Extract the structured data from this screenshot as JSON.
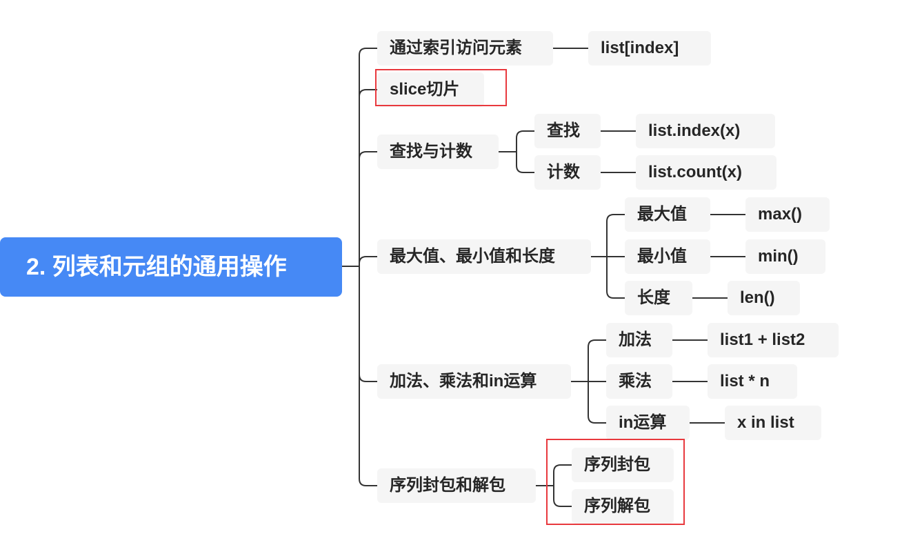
{
  "mindmap": {
    "root": {
      "label": "2. 列表和元组的通用操作",
      "color": "#4689f5"
    },
    "branches": [
      {
        "label": "通过索引访问元素",
        "children": [
          {
            "label": "list[index]"
          }
        ]
      },
      {
        "label": "slice切片",
        "highlighted": true,
        "children": []
      },
      {
        "label": "查找与计数",
        "children": [
          {
            "label": "查找",
            "children": [
              {
                "label": "list.index(x)"
              }
            ]
          },
          {
            "label": "计数",
            "children": [
              {
                "label": "list.count(x)"
              }
            ]
          }
        ]
      },
      {
        "label": "最大值、最小值和长度",
        "children": [
          {
            "label": "最大值",
            "children": [
              {
                "label": "max()"
              }
            ]
          },
          {
            "label": "最小值",
            "children": [
              {
                "label": "min()"
              }
            ]
          },
          {
            "label": "长度",
            "children": [
              {
                "label": "len()"
              }
            ]
          }
        ]
      },
      {
        "label": "加法、乘法和in运算",
        "children": [
          {
            "label": "加法",
            "children": [
              {
                "label": "list1 + list2"
              }
            ]
          },
          {
            "label": "乘法",
            "children": [
              {
                "label": "list * n"
              }
            ]
          },
          {
            "label": "in运算",
            "children": [
              {
                "label": "x in list"
              }
            ]
          }
        ]
      },
      {
        "label": "序列封包和解包",
        "children_highlighted": true,
        "children": [
          {
            "label": "序列封包"
          },
          {
            "label": "序列解包"
          }
        ]
      }
    ],
    "colors": {
      "node_bg": "#f5f5f5",
      "node_text": "#262626",
      "connector": "#333333",
      "highlight_box": "#e8383d"
    }
  }
}
